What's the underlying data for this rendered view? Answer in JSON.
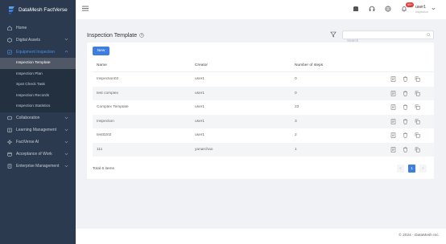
{
  "brand": {
    "name": "DataMesh FactVerse"
  },
  "sidebar": {
    "items": [
      {
        "label": "Home",
        "icon": "home-icon"
      },
      {
        "label": "Digital Assets",
        "icon": "cube-icon"
      },
      {
        "label": "Equipment Inspection",
        "icon": "inspection-icon",
        "children": [
          {
            "label": "Inspection Template"
          },
          {
            "label": "Inspection Plan"
          },
          {
            "label": "Spot Check Task"
          },
          {
            "label": "Inspection Records"
          },
          {
            "label": "Inspection Statistics"
          }
        ]
      },
      {
        "label": "Collaboration",
        "icon": "collaboration-icon"
      },
      {
        "label": "Learning Management",
        "icon": "book-icon"
      },
      {
        "label": "FactVerse AI",
        "icon": "ai-icon"
      },
      {
        "label": "Acceptance of Work",
        "icon": "calendar-icon"
      },
      {
        "label": "Enterprise Management",
        "icon": "building-icon"
      }
    ],
    "selected": "Inspection Template"
  },
  "header": {
    "notification_badge": "99+",
    "user_name": "user1",
    "user_role": "Inspection"
  },
  "page": {
    "title": "Inspection Template",
    "search_placeholder": "Search",
    "new_button": "New"
  },
  "table": {
    "columns": [
      "Name",
      "Creator",
      "Number of steps"
    ],
    "rows": [
      {
        "name": "Inspection02",
        "creator": "user1",
        "steps": "0"
      },
      {
        "name": "test complex",
        "creator": "user1",
        "steps": "0"
      },
      {
        "name": "Complex Template",
        "creator": "user1",
        "steps": "23"
      },
      {
        "name": "Inspection",
        "creator": "user1",
        "steps": "3"
      },
      {
        "name": "test0202",
        "creator": "user1",
        "steps": "2"
      },
      {
        "name": "111",
        "creator": "yanarchao",
        "steps": "1"
      }
    ]
  },
  "pagination": {
    "total": "Total 6 items",
    "current_page": "1",
    "prev": "<",
    "next": ">"
  },
  "footer": {
    "text": "© 2024 - DataMesh Inc."
  },
  "colors": {
    "sidebar_bg": "#2b3a4e",
    "accent": "#3d7ee0",
    "selected_item_bg": "#4f5864",
    "badge": "#e53935"
  }
}
